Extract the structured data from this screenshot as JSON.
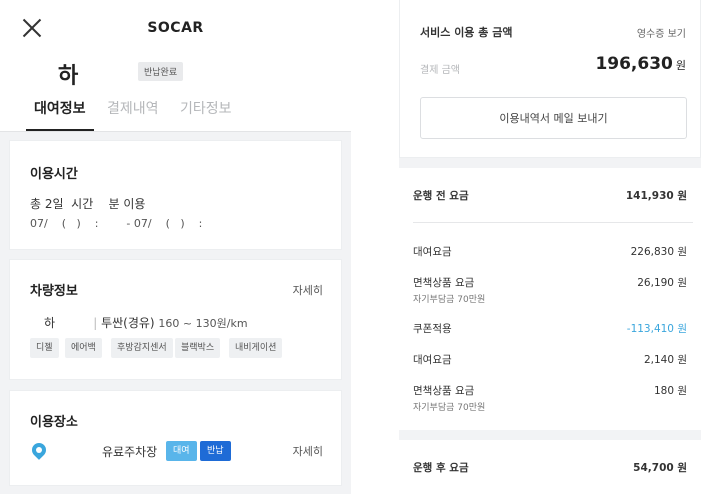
{
  "left": {
    "brand": "SOCAR",
    "car_title": "하",
    "status_pill": "반납완료",
    "tabs": [
      {
        "label": "대여정보",
        "active": true
      },
      {
        "label": "결제내역",
        "active": false
      },
      {
        "label": "기타정보",
        "active": false
      }
    ],
    "usage_time": {
      "title": "이용시간",
      "duration": "총 2일  시간    분 이용",
      "period": "07/    (   )    :        - 07/    (   )    :"
    },
    "vehicle": {
      "title": "차량정보",
      "detail_link": "자세히",
      "plate": "하",
      "model": "투싼(경유)",
      "price_per_km": "160 ~ 130원/km",
      "options": [
        "디젤",
        "에어백",
        "후방감지센서",
        "블랙박스",
        "내비게이션"
      ]
    },
    "place": {
      "title": "이용장소",
      "name": "유료주차장",
      "badge_rent": "대여",
      "badge_return": "반납",
      "detail_link": "자세히"
    }
  },
  "right": {
    "summary": {
      "title": "서비스 이용 총 금액",
      "receipt_link": "영수증 보기",
      "pay_label": "결제 금액",
      "pay_amount": "196,630",
      "pay_unit": "원",
      "mail_button": "이용내역서 메일 보내기"
    },
    "before": {
      "label": "운행 전 요금",
      "value": "141,930 원"
    },
    "rows": [
      {
        "label": "대여요금",
        "value": "226,830 원"
      },
      {
        "label": "면책상품 요금",
        "sub": "자기부담금 70만원",
        "value": "26,190 원"
      },
      {
        "label": "쿠폰적용",
        "value": "-113,410 원",
        "discount": true
      },
      {
        "label": "대여요금",
        "value": "2,140 원"
      },
      {
        "label": "면책상품 요금",
        "sub": "자기부담금 70만원",
        "value": "180 원"
      }
    ],
    "after": {
      "label": "운행 후 요금",
      "value": "54,700 원"
    }
  },
  "colors": {
    "accent_blue": "#1e6bd6",
    "light_blue": "#59b5ea",
    "discount": "#3aa6dd",
    "background": "#f2f3f5"
  }
}
